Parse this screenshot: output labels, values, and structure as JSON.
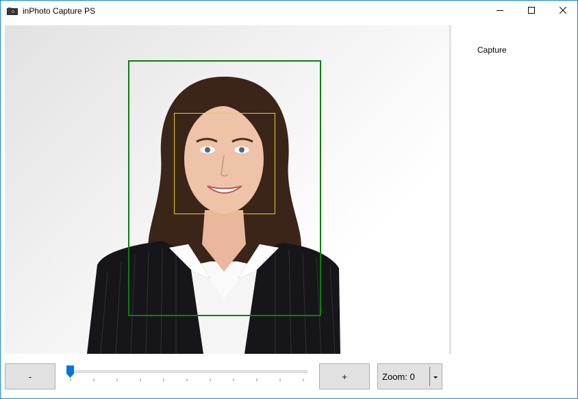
{
  "window": {
    "title": "inPhoto Capture PS",
    "app_icon": "camera-icon",
    "controls": [
      "minimize-icon",
      "maximize-icon",
      "close-icon"
    ]
  },
  "preview": {
    "subject": "portrait-photo",
    "guide_box_color": "#0e7d0e",
    "face_box_color": "#e8d41c"
  },
  "sidebar": {
    "capture_label": "Capture"
  },
  "controls": {
    "minus_label": "-",
    "plus_label": "+",
    "zoom_label": "Zoom: 0",
    "zoom_value": 0,
    "slider_tick_count": 11
  },
  "colors": {
    "window_border": "#1883d7",
    "slider_thumb": "#0078d7",
    "button_bg": "#e1e1e1"
  }
}
